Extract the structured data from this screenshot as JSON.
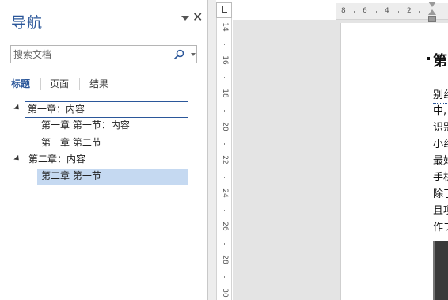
{
  "nav": {
    "title": "导航",
    "search_placeholder": "搜索文档",
    "tabs": [
      "标题",
      "页面",
      "结果"
    ],
    "tree": [
      {
        "label": "第一章：内容",
        "level": 1,
        "expanded": true,
        "state": "focused"
      },
      {
        "label": "第一章 第一节：内容",
        "level": 2
      },
      {
        "label": "第一章 第二节",
        "level": 2
      },
      {
        "label": "第二章：内容",
        "level": 1,
        "expanded": true
      },
      {
        "label": "第二章 第一节",
        "level": 2,
        "state": "selected"
      }
    ]
  },
  "ruler": {
    "horizontal": [
      "8",
      "6",
      "4",
      "2"
    ],
    "vertical": [
      "14",
      "16",
      "18",
      "20",
      "22",
      "24",
      "26",
      "28",
      "30"
    ]
  },
  "document": {
    "heading": "第",
    "lines": [
      "别纟",
      "中,",
      "识别",
      "小纟",
      "最好",
      "手机",
      "除了",
      "且项",
      "作ブ"
    ]
  },
  "colors": {
    "accent": "#2b579a",
    "selection": "#c5d9f1"
  }
}
